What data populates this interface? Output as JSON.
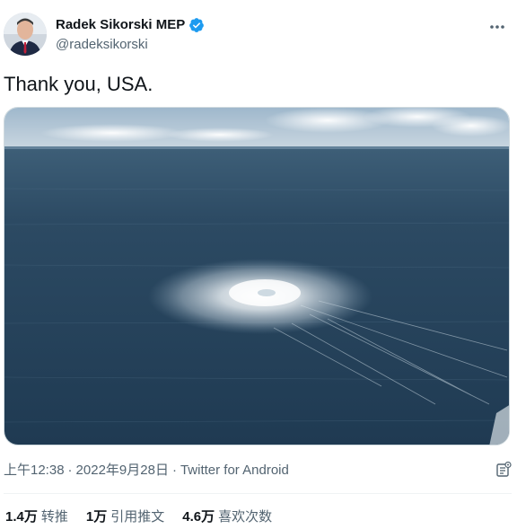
{
  "author": {
    "display_name": "Radek Sikorski MEP",
    "handle": "@radeksikorski",
    "verified": true
  },
  "tweet": {
    "text": "Thank you, USA."
  },
  "media": {
    "description_icon": "photo-sea-gas-leak"
  },
  "meta": {
    "time": "上午12:38",
    "separator1": "·",
    "date": "2022年9月28日",
    "separator2": "·",
    "source": "Twitter for Android"
  },
  "stats": [
    {
      "value": "1.4万",
      "label": "转推"
    },
    {
      "value": "1万",
      "label": "引用推文"
    },
    {
      "value": "4.6万",
      "label": "喜欢次数"
    }
  ],
  "colors": {
    "verified_blue": "#1d9bf0",
    "secondary_text": "#536471",
    "primary_text": "#0f1419"
  }
}
